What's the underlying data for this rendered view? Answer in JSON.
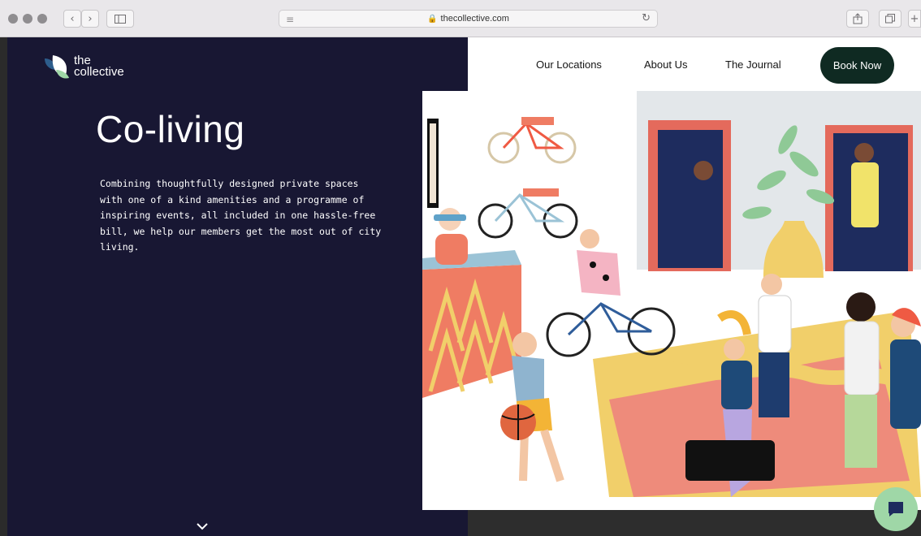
{
  "browser": {
    "url": "thecollective.com",
    "icons": [
      "back-icon",
      "forward-icon",
      "sidebar-icon",
      "reader-icon",
      "lock-icon",
      "reload-icon",
      "share-icon",
      "tabs-icon",
      "new-tab-icon"
    ]
  },
  "brand": {
    "name_line1": "the",
    "name_line2": "collective"
  },
  "nav": {
    "locations": "Our Locations",
    "about": "About Us",
    "journal": "The Journal",
    "book": "Book Now"
  },
  "hero": {
    "title": "Co-living",
    "description": "Combining thoughtfully designed private spaces with one of a kind amenities and a programme of inspiring events, all included in one hassle-free bill, we help our members get the most out of city living."
  },
  "colors": {
    "left_panel": "#181733",
    "book_button": "#0f2a22",
    "chat_button": "#9fd7a7"
  }
}
